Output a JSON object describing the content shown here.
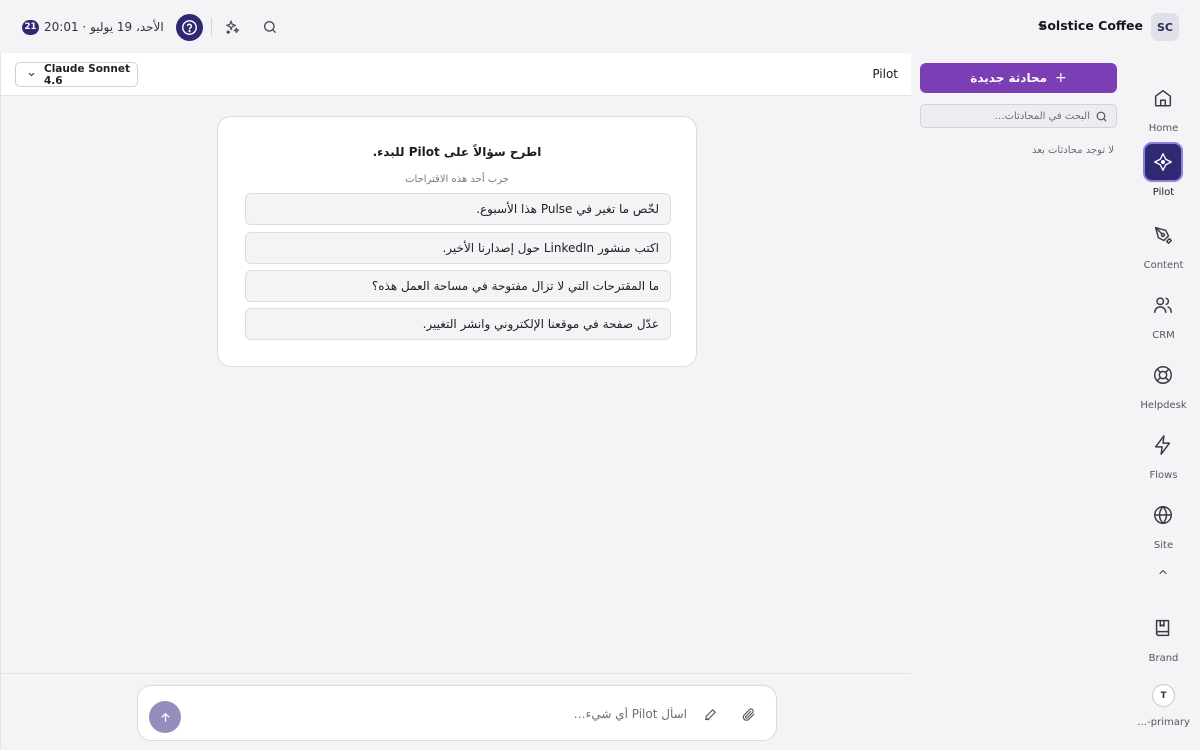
{
  "topbar": {
    "workspace_initials": "SC",
    "workspace_name": "Solstice Coffee",
    "day_badge": "21",
    "datetime": "الأحد، 19 يوليو · 20:01",
    "icons": [
      "help-circle-icon",
      "sparkles-icon",
      "search-icon"
    ]
  },
  "chat": {
    "title": "Pilot",
    "model": "Claude Sonnet 4.6",
    "starter_title": "اطرح سؤالاً على Pilot للبدء.",
    "starter_subtitle": "جرب أحد هذه الاقتراحات",
    "suggestions": [
      "لخّص ما تغير في Pulse هذا الأسبوع.",
      "اكتب منشور LinkedIn حول إصدارنا الأخير.",
      "ما المقترحات التي لا تزال مفتوحة في مساحة العمل هذه؟",
      "عدّل صفحة في موقعنا الإلكتروني وانشر التغيير."
    ],
    "composer_placeholder": "اسأل Pilot أي شيء…"
  },
  "conversations": {
    "new_chat_label": "محادثة جديدة",
    "search_placeholder": "البحث في المحادثات…",
    "empty_text": "لا توجد محادثات بعد"
  },
  "rail": {
    "items": [
      {
        "label": "Home",
        "icon": "home-icon"
      },
      {
        "label": "Pilot",
        "icon": "pilot-icon",
        "active": true
      },
      {
        "label": "Content",
        "icon": "pen-tool-icon"
      },
      {
        "label": "CRM",
        "icon": "users-icon"
      },
      {
        "label": "Helpdesk",
        "icon": "life-buoy-icon"
      },
      {
        "label": "Flows",
        "icon": "zap-icon"
      },
      {
        "label": "Site",
        "icon": "globe-icon"
      },
      {
        "label": "Brand",
        "icon": "book-icon"
      }
    ],
    "user_initial": "T",
    "user_label": "…-primary"
  },
  "colors": {
    "accent_purple": "#7c3eb5",
    "navy": "#2f2973",
    "send_button": "#978dbd"
  }
}
